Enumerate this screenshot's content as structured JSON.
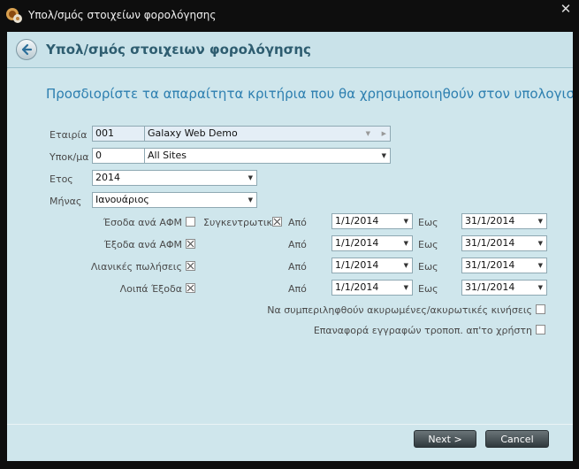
{
  "window": {
    "title": "Υπολ/σμός στοιχείων φορολόγησης",
    "close": "✕"
  },
  "header": {
    "title": "Υπολ/σμός στοιχειων φορολόγησης"
  },
  "subtitle": "Προσδιορίστε τα απαραίτητα κριτήρια που θα χρησιμοποιηθούν στον υπολογισ",
  "form": {
    "company_label": "Εταιρία",
    "company_code": "001",
    "company_name": "Galaxy Web Demo",
    "site_label": "Υποκ/μα",
    "site_code": "0",
    "site_name": "All Sites",
    "year_label": "Ετος",
    "year_value": "2014",
    "month_label": "Μήνας",
    "month_value": "Ιανουάριος"
  },
  "rows": [
    {
      "label": "Έσοδα ανά ΑΦΜ",
      "checked": false,
      "from_label": "Από",
      "from": "1/1/2014",
      "to_label": "Εως",
      "to": "31/1/2014"
    },
    {
      "label": "Έξοδα ανά ΑΦΜ",
      "checked": true,
      "from_label": "Από",
      "from": "1/1/2014",
      "to_label": "Εως",
      "to": "31/1/2014"
    },
    {
      "label": "Λιανικές πωλήσεις",
      "checked": true,
      "from_label": "Από",
      "from": "1/1/2014",
      "to_label": "Εως",
      "to": "31/1/2014"
    },
    {
      "label": "Λοιπά Έξοδα",
      "checked": true,
      "from_label": "Από",
      "from": "1/1/2014",
      "to_label": "Εως",
      "to": "31/1/2014"
    }
  ],
  "summary": {
    "label": "Συγκεντρωτικά",
    "checked": true
  },
  "options": {
    "include_cancelled_label": "Να συμπεριληφθούν ακυρωμένες/ακυρωτικές κινήσεις",
    "include_cancelled": false,
    "restore_modified_label": "Επαναφορά εγγραφών τροποπ. απ'το χρήστη",
    "restore_modified": false
  },
  "buttons": {
    "next": "Next >",
    "cancel": "Cancel"
  },
  "icons": {
    "app": "app-logo-icon",
    "back": "back-arrow-icon",
    "dropdown": "chevron-down-icon"
  }
}
